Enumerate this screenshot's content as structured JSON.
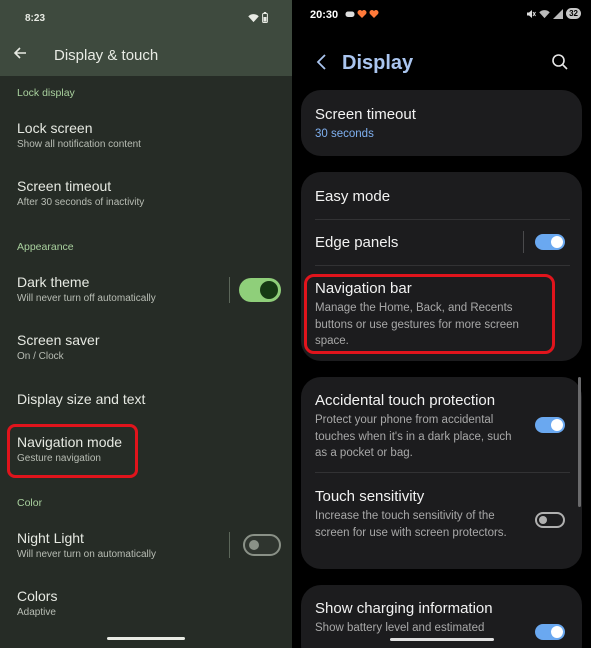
{
  "left": {
    "status_time": "8:23",
    "title": "Display & touch",
    "sections": {
      "lock_display": "Lock display",
      "appearance": "Appearance",
      "color": "Color"
    },
    "items": {
      "lock_screen": {
        "title": "Lock screen",
        "subtitle": "Show all notification content"
      },
      "screen_timeout": {
        "title": "Screen timeout",
        "subtitle": "After 30 seconds of inactivity"
      },
      "dark_theme": {
        "title": "Dark theme",
        "subtitle": "Will never turn off automatically",
        "enabled": true
      },
      "screen_saver": {
        "title": "Screen saver",
        "subtitle": "On / Clock"
      },
      "display_size": {
        "title": "Display size and text"
      },
      "navigation_mode": {
        "title": "Navigation mode",
        "subtitle": "Gesture navigation"
      },
      "night_light": {
        "title": "Night Light",
        "subtitle": "Will never turn on automatically",
        "enabled": false
      },
      "colors": {
        "title": "Colors",
        "subtitle": "Adaptive"
      }
    },
    "colors": {
      "accent": "#a9d19e",
      "highlight": "#e0141c"
    }
  },
  "right": {
    "status_time": "20:30",
    "battery": "32",
    "title": "Display",
    "items": {
      "screen_timeout": {
        "title": "Screen timeout",
        "subtitle": "30 seconds"
      },
      "easy_mode": {
        "title": "Easy mode"
      },
      "edge_panels": {
        "title": "Edge panels",
        "enabled": true
      },
      "navigation_bar": {
        "title": "Navigation bar",
        "subtitle": "Manage the Home, Back, and Recents buttons or use gestures for more screen space."
      },
      "accidental_touch": {
        "title": "Accidental touch protection",
        "subtitle": "Protect your phone from accidental touches when it's in a dark place, such as a pocket or bag.",
        "enabled": true
      },
      "touch_sensitivity": {
        "title": "Touch sensitivity",
        "subtitle": "Increase the touch sensitivity of the screen for use with screen protectors.",
        "enabled": false
      },
      "charging_info": {
        "title": "Show charging information",
        "subtitle": "Show battery level and estimated",
        "enabled": true
      }
    },
    "colors": {
      "accent": "#aac5ef",
      "highlight": "#e0141c"
    }
  }
}
